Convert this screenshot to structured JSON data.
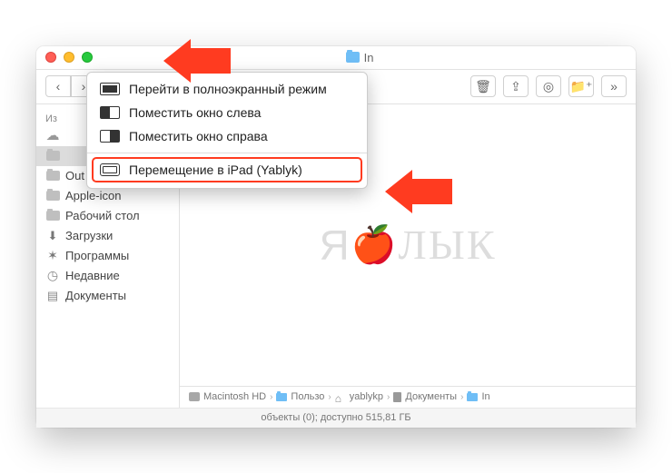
{
  "title": "In",
  "menu": {
    "fullscreen": "Перейти в полноэкранный режим",
    "left": "Поместить окно слева",
    "right": "Поместить окно справа",
    "ipad": "Перемещение в iPad (Yablyk)"
  },
  "sidebar": {
    "header": "Из",
    "items": [
      {
        "label": "",
        "icon": "cloud"
      },
      {
        "label": "",
        "icon": "folder",
        "sel": true
      },
      {
        "label": "Out",
        "icon": "folder"
      },
      {
        "label": "Apple-icon",
        "icon": "folder"
      },
      {
        "label": "Рабочий стол",
        "icon": "folder"
      },
      {
        "label": "Загрузки",
        "icon": "download"
      },
      {
        "label": "Программы",
        "icon": "apps"
      },
      {
        "label": "Недавние",
        "icon": "clock"
      },
      {
        "label": "Документы",
        "icon": "docs"
      }
    ]
  },
  "watermark": "ЯБЛЫК",
  "path": {
    "p0": "Macintosh HD",
    "p1": "Пользо",
    "p2": "yablykp",
    "p3": "Документы",
    "p4": "In"
  },
  "status": "объекты (0); доступно 515,81 ГБ",
  "chevron": "›",
  "doublechev": "»"
}
